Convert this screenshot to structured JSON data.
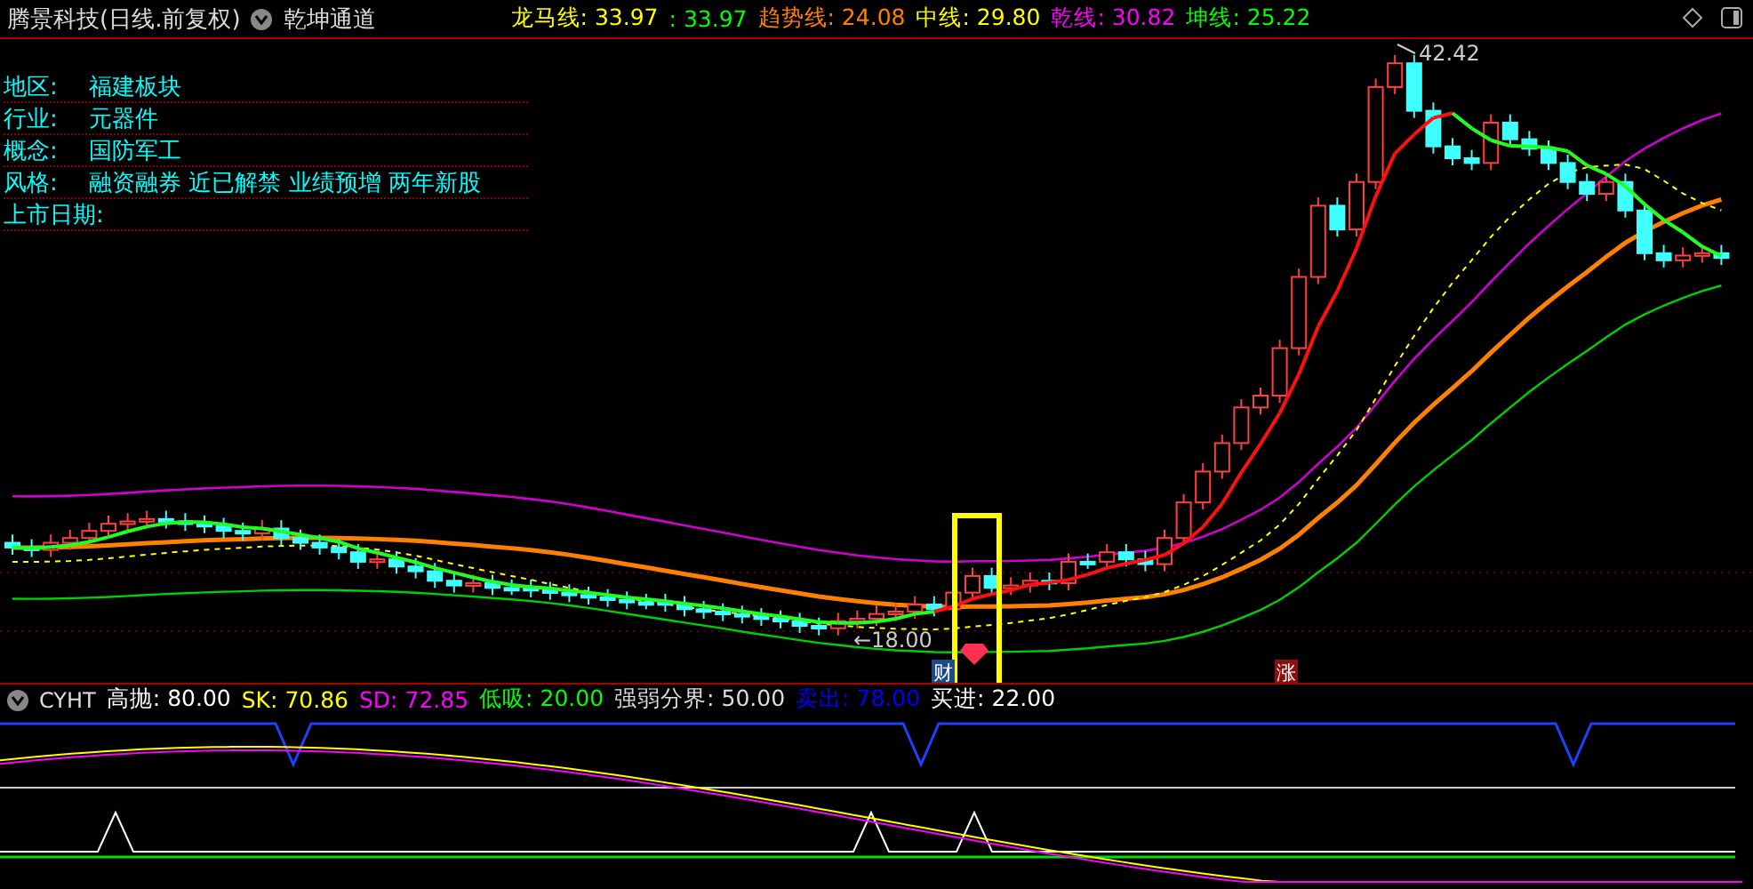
{
  "header": {
    "title": "腾景科技(日线.前复权)",
    "indicator": "乾坤通道",
    "values": [
      {
        "text": "龙马线: 33.97",
        "color": "#ffff00"
      },
      {
        "text": ": 33.97",
        "color": "#00ff00"
      },
      {
        "text": "趋势线: 24.08",
        "color": "#ff8000"
      },
      {
        "text": "中线: 29.80",
        "color": "#ffff00"
      },
      {
        "text": "乾线: 30.82",
        "color": "#ff00ff"
      },
      {
        "text": "坤线: 25.22",
        "color": "#00ff00"
      }
    ]
  },
  "info": [
    {
      "label": "地区:",
      "value": "福建板块"
    },
    {
      "label": "行业:",
      "value": "元器件"
    },
    {
      "label": "概念:",
      "value": "国防军工"
    },
    {
      "label": "风格:",
      "value": "融资融券 近已解禁 业绩预增 两年新股"
    },
    {
      "label": "上市日期:"
    }
  ],
  "chart": {
    "high_label": "42.42",
    "low_label": "←18.00",
    "markers": [
      {
        "text": "财",
        "color": "#1a4a8a"
      },
      {
        "text": "涨",
        "color": "#8a1010"
      }
    ]
  },
  "indicator": {
    "name": "CYHT",
    "values": [
      {
        "label": "高抛:",
        "value": "80.00",
        "color": "#ffffff"
      },
      {
        "label": "SK:",
        "value": "70.86",
        "color": "#ffff00"
      },
      {
        "label": "SD:",
        "value": "72.85",
        "color": "#ff00ff"
      },
      {
        "label": "低吸:",
        "value": "20.00",
        "color": "#00ff00"
      },
      {
        "label": "强弱分界:",
        "value": "50.00",
        "color": "#dddddd"
      },
      {
        "label": "卖出:",
        "value": "78.00",
        "color": "#0000ff"
      },
      {
        "label": "买进:",
        "value": "22.00",
        "color": "#ffffff"
      }
    ]
  }
}
